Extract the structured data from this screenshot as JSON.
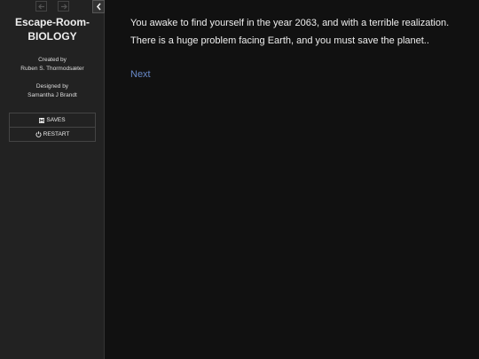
{
  "sidebar": {
    "history_back_icon": "arrow-left-icon",
    "history_forward_icon": "arrow-right-icon",
    "toggle_icon": "chevron-left-icon",
    "title_line1": "Escape-Room-",
    "title_line2": "BIOLOGY",
    "created_by_label": "Created by",
    "created_by_name": "Ruben S. Thormodsæter",
    "designed_by_label": "Designed by",
    "designed_by_name": "Samantha J Brandt",
    "menu": {
      "saves_label": "SAVES",
      "saves_icon": "floppy-disk-icon",
      "restart_label": "RESTART",
      "restart_icon": "power-icon"
    }
  },
  "passage": {
    "line1": "You awake to find yourself in the year 2063, and with a terrible realization.",
    "line2": "There is a huge problem facing Earth, and you must save the planet..",
    "next_link": "Next"
  },
  "colors": {
    "background": "#111111",
    "sidebar": "#222222",
    "link": "#6889c8",
    "text": "#eeeeee"
  }
}
